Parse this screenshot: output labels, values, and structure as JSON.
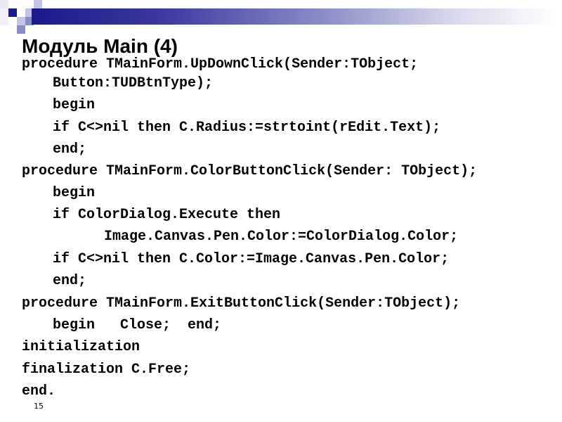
{
  "slide": {
    "title": "Модуль Main (4)",
    "page_number": "15",
    "accent_color": "#1a1a8c",
    "code_lines": [
      "procedure TMainForm.UpDownClick(Sender:TObject;",
      "Button:TUDBtnType);",
      "begin",
      "if C<>nil then C.Radius:=strtoint(rEdit.Text);",
      "end;",
      "procedure TMainForm.ColorButtonClick(Sender: TObject);",
      "begin",
      "if ColorDialog.Execute then",
      "Image.Canvas.Pen.Color:=ColorDialog.Color;",
      "if C<>nil then C.Color:=Image.Canvas.Pen.Color;",
      "end;",
      "procedure TMainForm.ExitButtonClick(Sender:TObject);",
      "begin   Close;  end;",
      "initialization",
      "finalization C.Free;",
      "end."
    ]
  }
}
